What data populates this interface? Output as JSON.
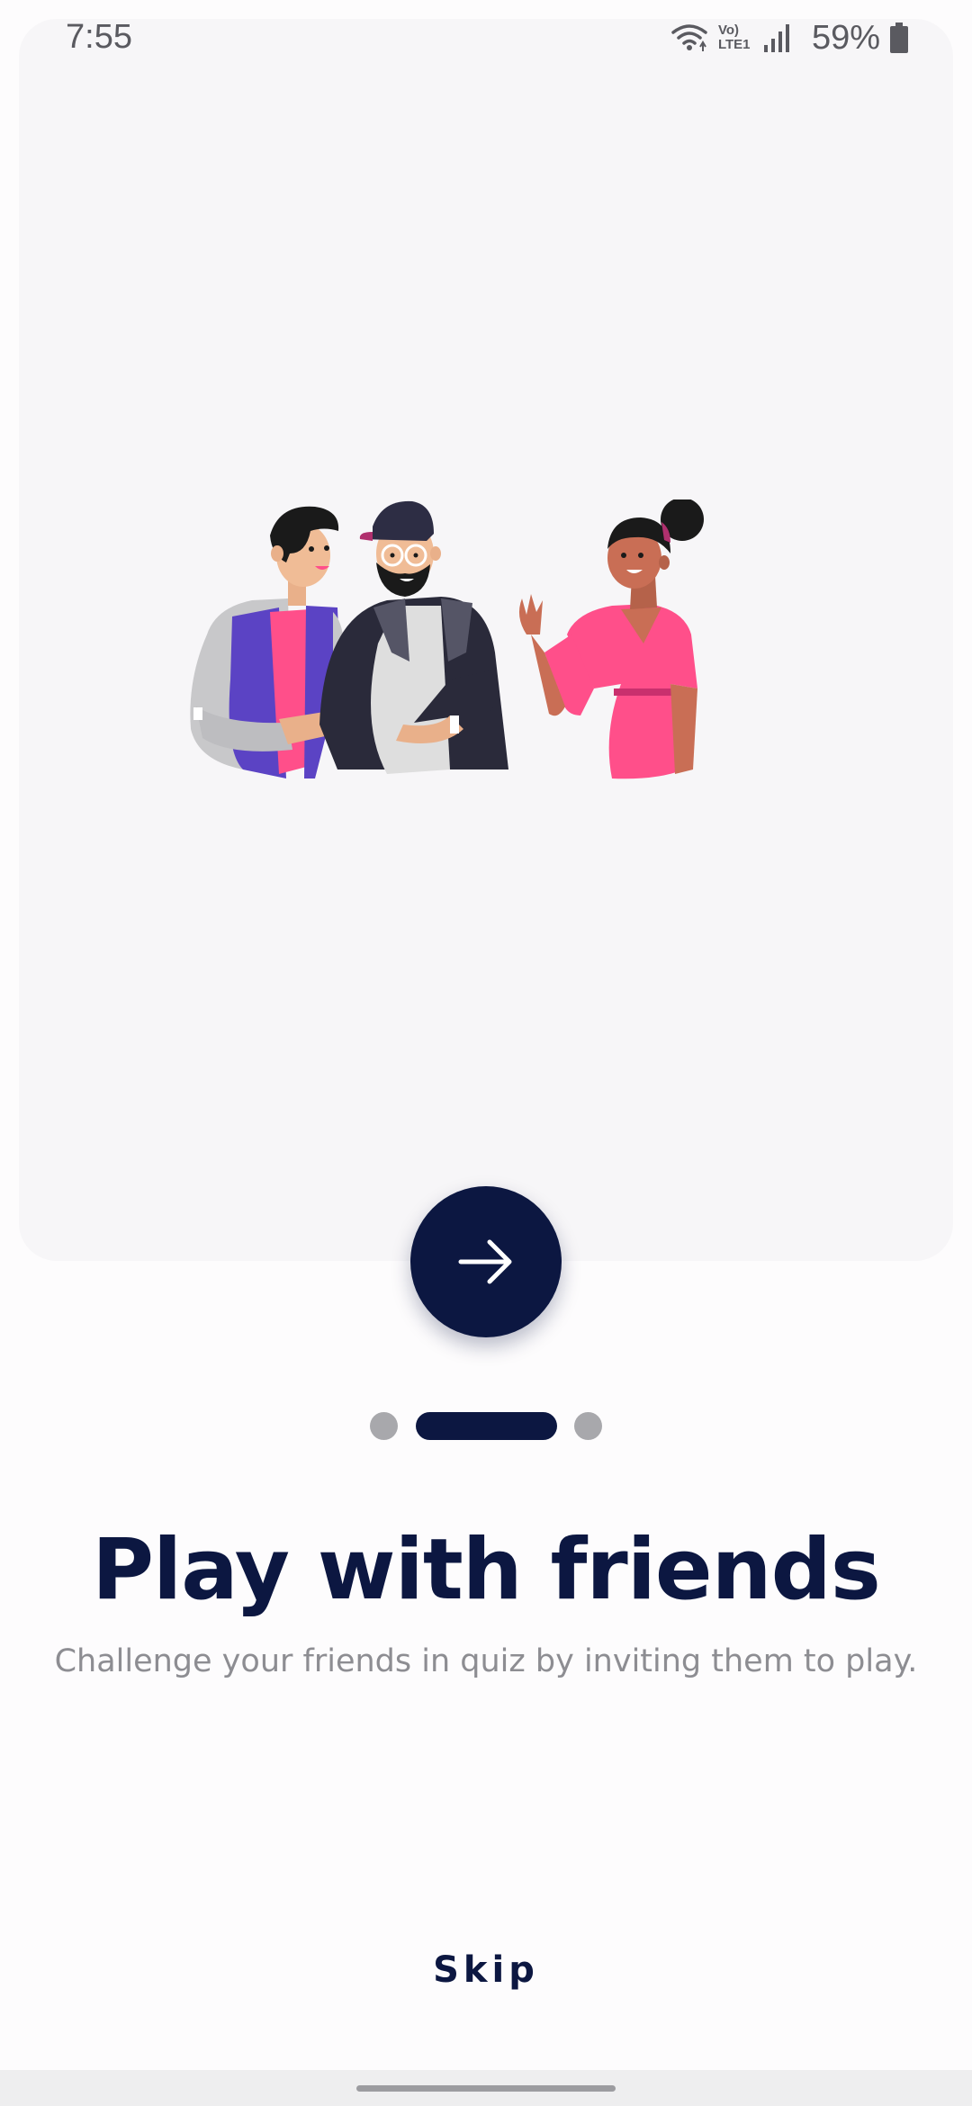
{
  "status_bar": {
    "time": "7:55",
    "battery_percent": "59%",
    "network_label": "Vo) LTE1",
    "icons": [
      "wifi-icon",
      "volte-icon",
      "signal-icon",
      "battery-icon"
    ]
  },
  "onboarding": {
    "illustration": "three-friends-illustration",
    "next_button_icon": "arrow-right-icon",
    "pages": {
      "total": 3,
      "current": 2
    },
    "title": "Play with friends",
    "subtitle": "Challenge your friends in quiz by inviting them to play.",
    "skip_label": "Skip"
  },
  "colors": {
    "primary": "#0c1741",
    "card_background": "#f7f6f8",
    "page_background": "#fdfcfd",
    "inactive_dot": "#a8a8ac",
    "subtitle_text": "#8d8d92"
  }
}
